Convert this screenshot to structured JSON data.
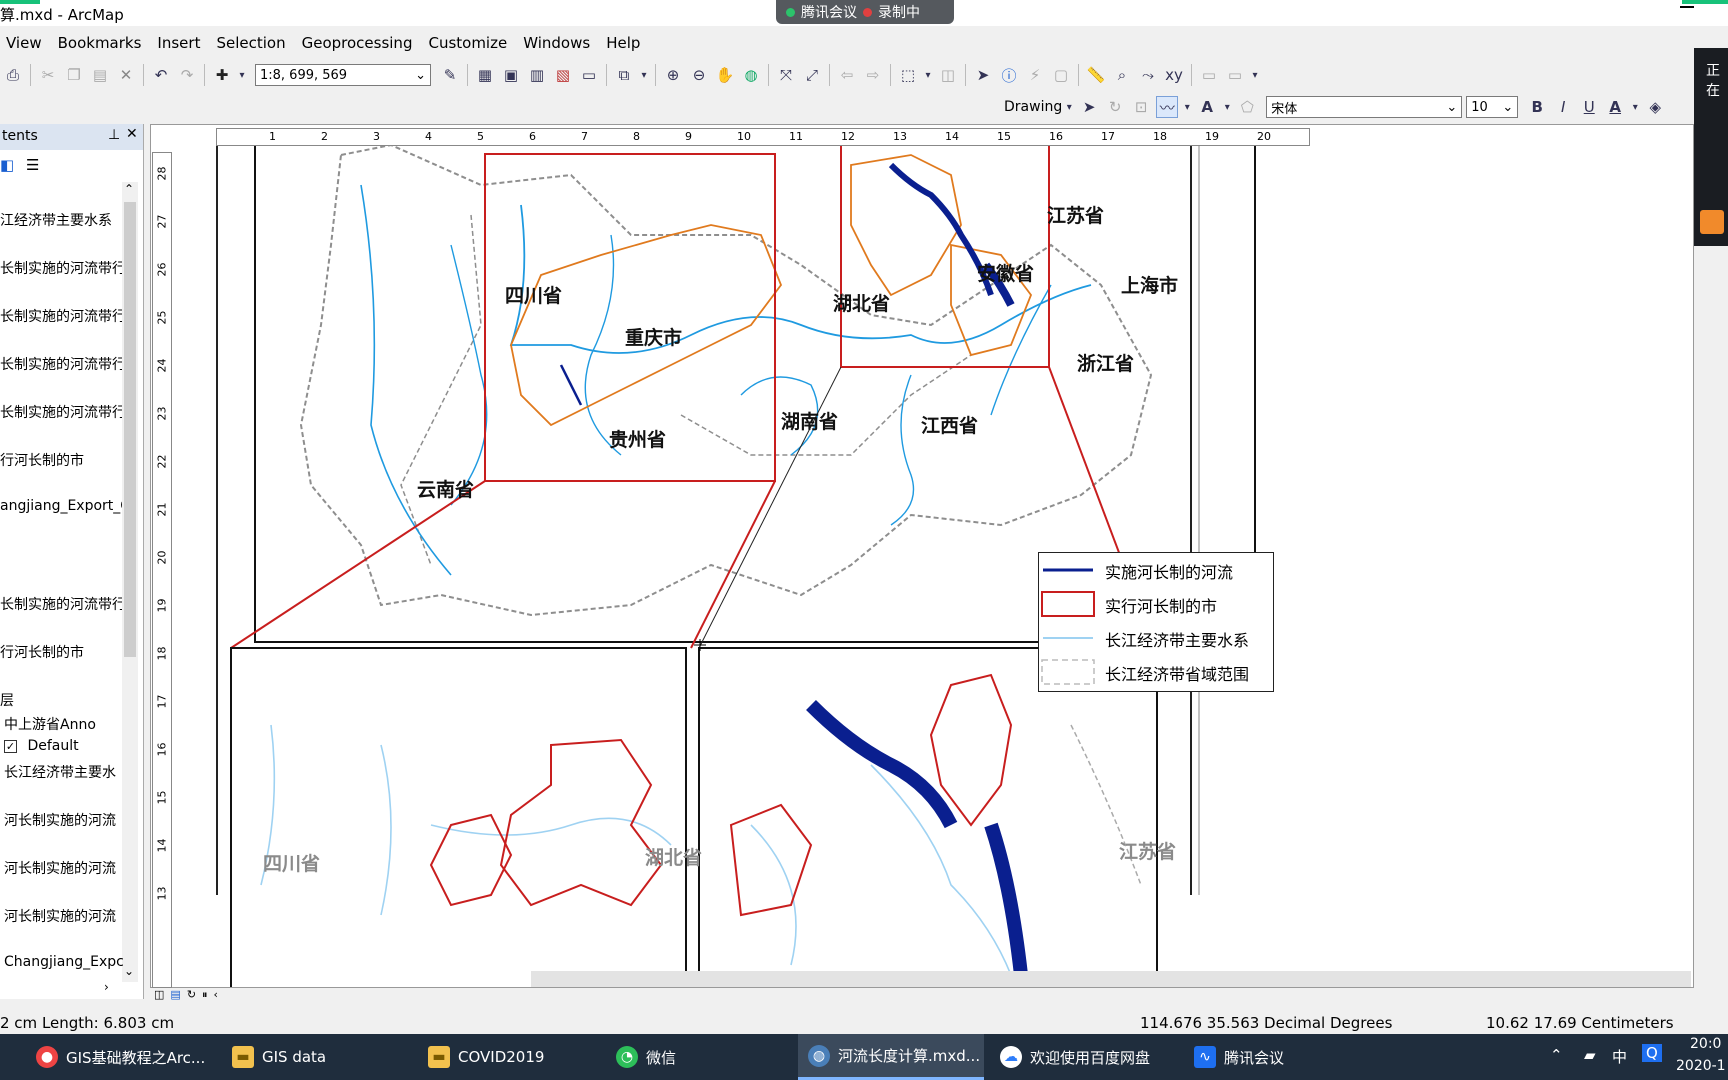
{
  "window": {
    "title": "算.mxd - ArcMap"
  },
  "meeting_bar": {
    "app": "腾讯会议",
    "recording": "录制中"
  },
  "menu": [
    "View",
    "Bookmarks",
    "Insert",
    "Selection",
    "Geoprocessing",
    "Customize",
    "Windows",
    "Help"
  ],
  "toolbar": {
    "scale_value": "1:8, 699, 569",
    "drawing_label": "Drawing",
    "font_name": "宋体",
    "font_size": "10"
  },
  "toc": {
    "header": "tents",
    "items": [
      "江经济带主要水系",
      "长制实施的河流带行",
      "长制实施的河流带行",
      "长制实施的河流带行",
      "长制实施的河流带行",
      "行河长制的市",
      "angjiang_Export_C",
      "长制实施的河流带行",
      "行河长制的市",
      "层",
      "中上游省Anno",
      "Default",
      "长江经济带主要水",
      "河长制实施的河流",
      "河长制实施的河流",
      "河长制实施的河流",
      "Changjiang_Expc"
    ]
  },
  "ruler": {
    "h": [
      "1",
      "2",
      "3",
      "4",
      "5",
      "6",
      "7",
      "8",
      "9",
      "10",
      "11",
      "12",
      "13",
      "14",
      "15",
      "16",
      "17",
      "18",
      "19",
      "20"
    ],
    "v": [
      "28",
      "27",
      "26",
      "25",
      "24",
      "23",
      "22",
      "21",
      "20",
      "19",
      "18",
      "17",
      "16",
      "15",
      "14",
      "13"
    ]
  },
  "map": {
    "labels": [
      "四川省",
      "重庆市",
      "湖北省",
      "贵州省",
      "湖南省",
      "云南省",
      "安徽省",
      "江苏省",
      "上海市",
      "浙江省",
      "江西省"
    ],
    "inset_labels": [
      "四川省",
      "湖北省",
      "江苏省"
    ],
    "colors": {
      "river_main": "#1f9ae0",
      "river_impl": "#0a1f8f",
      "city_border": "#c81e1e",
      "province_border": "#e07a1e",
      "boundary": "#999999"
    }
  },
  "legend": [
    "实施河长制的河流",
    "实行河长制的市",
    "长江经济带主要水系",
    "长江经济带省域范围"
  ],
  "status": {
    "left": "2 cm   Length: 6.803 cm",
    "coords": "114.676  35.563 Decimal Degrees",
    "page": "10.62  17.69 Centimeters"
  },
  "taskbar": {
    "tasks": [
      "GIS基础教程之Arc...",
      "GIS data",
      "COVID2019",
      "微信",
      "河流长度计算.mxd...",
      "欢迎使用百度网盘",
      "腾讯会议"
    ],
    "tray_ime": "中",
    "time": "20:0",
    "date": "2020-1"
  }
}
